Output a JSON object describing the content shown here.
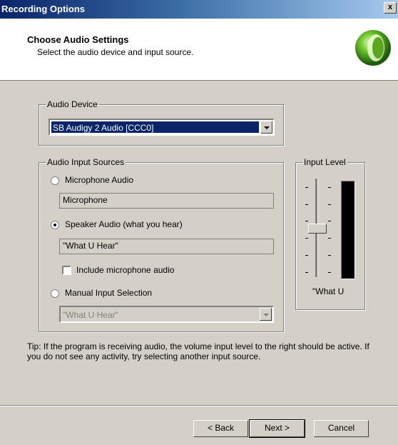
{
  "window": {
    "title": "Recording Options",
    "close_label": "x"
  },
  "header": {
    "title": "Choose Audio Settings",
    "subtitle": "Select the audio device and input source."
  },
  "audio_device": {
    "label": "Audio Device",
    "selected": "SB Audigy 2 Audio [CCC0]"
  },
  "input_sources": {
    "label": "Audio Input Sources",
    "microphone": {
      "label": "Microphone Audio",
      "field": "Microphone",
      "selected": false
    },
    "speaker": {
      "label": "Speaker Audio (what you hear)",
      "field": "\"What U Hear\"",
      "selected": true
    },
    "include_mic": {
      "label": "Include microphone audio",
      "checked": false
    },
    "manual": {
      "label": "Manual Input Selection",
      "selected_value": "\"What U Hear\"",
      "selected": false
    }
  },
  "input_level": {
    "label": "Input Level",
    "source": "\"What U",
    "slider_level": 0.55
  },
  "tip": "Tip: If the program is receiving audio, the volume input level to the right should be active.  If you do not see any activity, try selecting another input source.",
  "buttons": {
    "back": "< Back",
    "next": "Next >",
    "cancel": "Cancel"
  }
}
